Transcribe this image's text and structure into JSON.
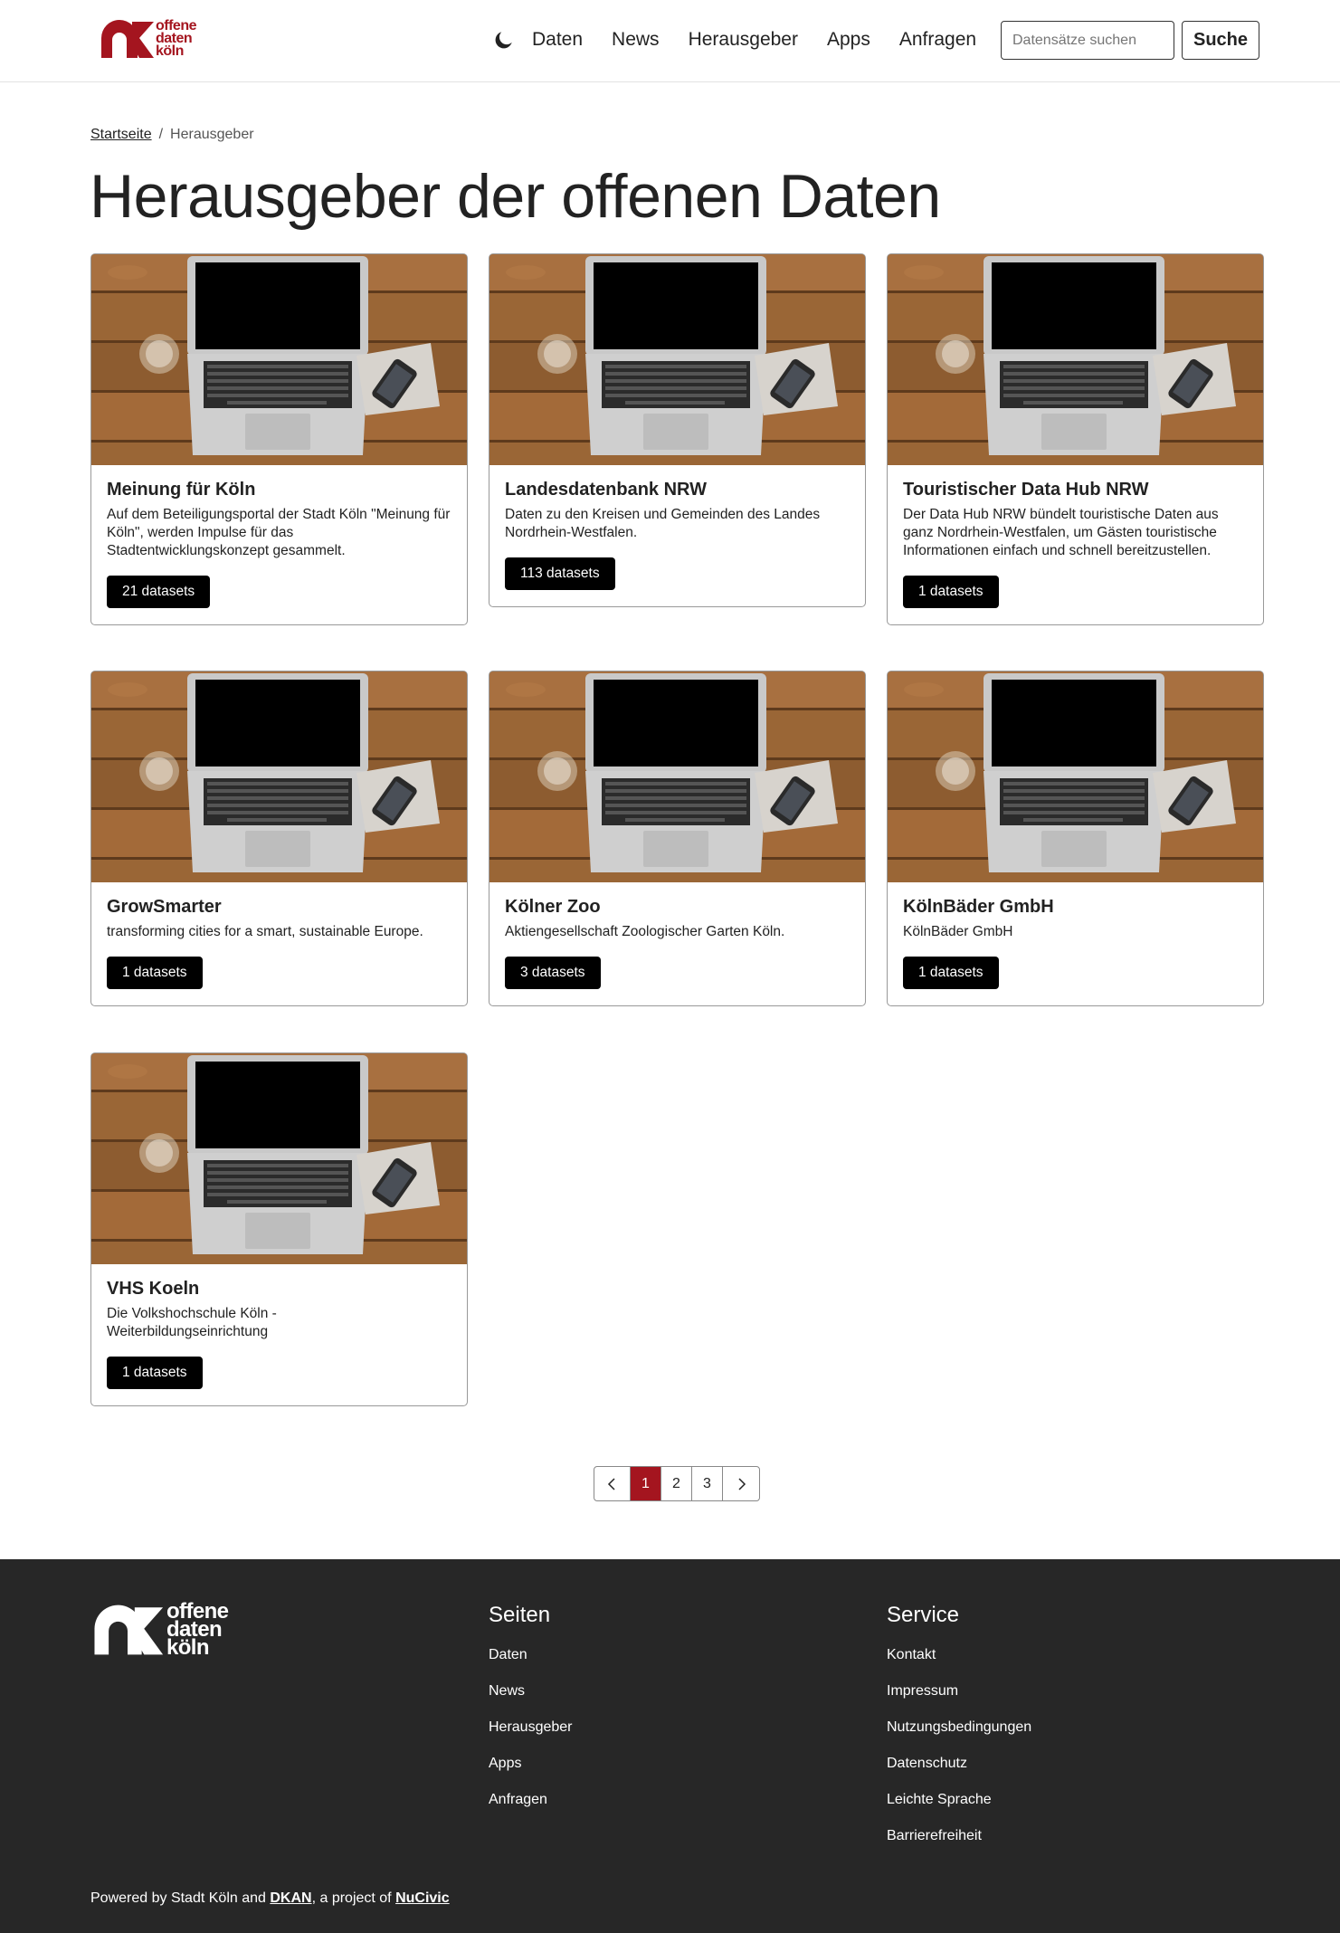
{
  "header": {
    "logo_text": [
      "offene",
      "daten",
      "köln"
    ],
    "nav": [
      "Daten",
      "News",
      "Herausgeber",
      "Apps",
      "Anfragen"
    ],
    "search_placeholder": "Datensätze suchen",
    "search_button": "Suche"
  },
  "breadcrumb": {
    "home": "Startseite",
    "separator": "/",
    "current": "Herausgeber"
  },
  "page_title": "Herausgeber der offenen Daten",
  "cards": [
    {
      "title": "Meinung für Köln",
      "desc": "Auf dem Beteiligungsportal der Stadt Köln \"Meinung für Köln\", werden Impulse für das Stadtentwicklungskonzept gesammelt.",
      "badge": "21 datasets"
    },
    {
      "title": "Landesdatenbank NRW",
      "desc": "Daten zu den Kreisen und Gemeinden des Landes Nordrhein-Westfalen.",
      "badge": "113 datasets"
    },
    {
      "title": "Touristischer Data Hub NRW",
      "desc": "Der Data Hub NRW bündelt touristische Daten aus ganz Nordrhein-Westfalen, um Gästen touristische Informationen einfach und schnell bereitzustellen.",
      "badge": "1 datasets"
    },
    {
      "title": "GrowSmarter",
      "desc": "transforming cities for a smart, sustainable Europe.",
      "badge": "1 datasets"
    },
    {
      "title": "Kölner Zoo",
      "desc": "Aktiengesellschaft Zoologischer Garten Köln.",
      "badge": "3 datasets"
    },
    {
      "title": "KölnBäder GmbH",
      "desc": "KölnBäder GmbH",
      "badge": "1 datasets"
    },
    {
      "title": "VHS Koeln",
      "desc": "Die Volkshochschule Köln - Weiterbildungseinrichtung",
      "badge": "1 datasets"
    }
  ],
  "pagination": {
    "prev_icon": "chevron-left-icon",
    "pages": [
      "1",
      "2",
      "3"
    ],
    "active": "1",
    "next_icon": "chevron-right-icon"
  },
  "footer": {
    "logo_text": [
      "offene",
      "daten",
      "köln"
    ],
    "seiten_title": "Seiten",
    "seiten_links": [
      "Daten",
      "News",
      "Herausgeber",
      "Apps",
      "Anfragen"
    ],
    "service_title": "Service",
    "service_links": [
      "Kontakt",
      "Impressum",
      "Nutzungsbedingungen",
      "Datenschutz",
      "Leichte Sprache",
      "Barrierefreiheit"
    ],
    "powered_prefix": "Powered by Stadt Köln and ",
    "powered_link1": "DKAN",
    "powered_middle": ", a project of ",
    "powered_link2": "NuCivic"
  },
  "colors": {
    "brand_red": "#a4151f",
    "footer_bg": "#272727",
    "badge_bg": "#000000"
  }
}
